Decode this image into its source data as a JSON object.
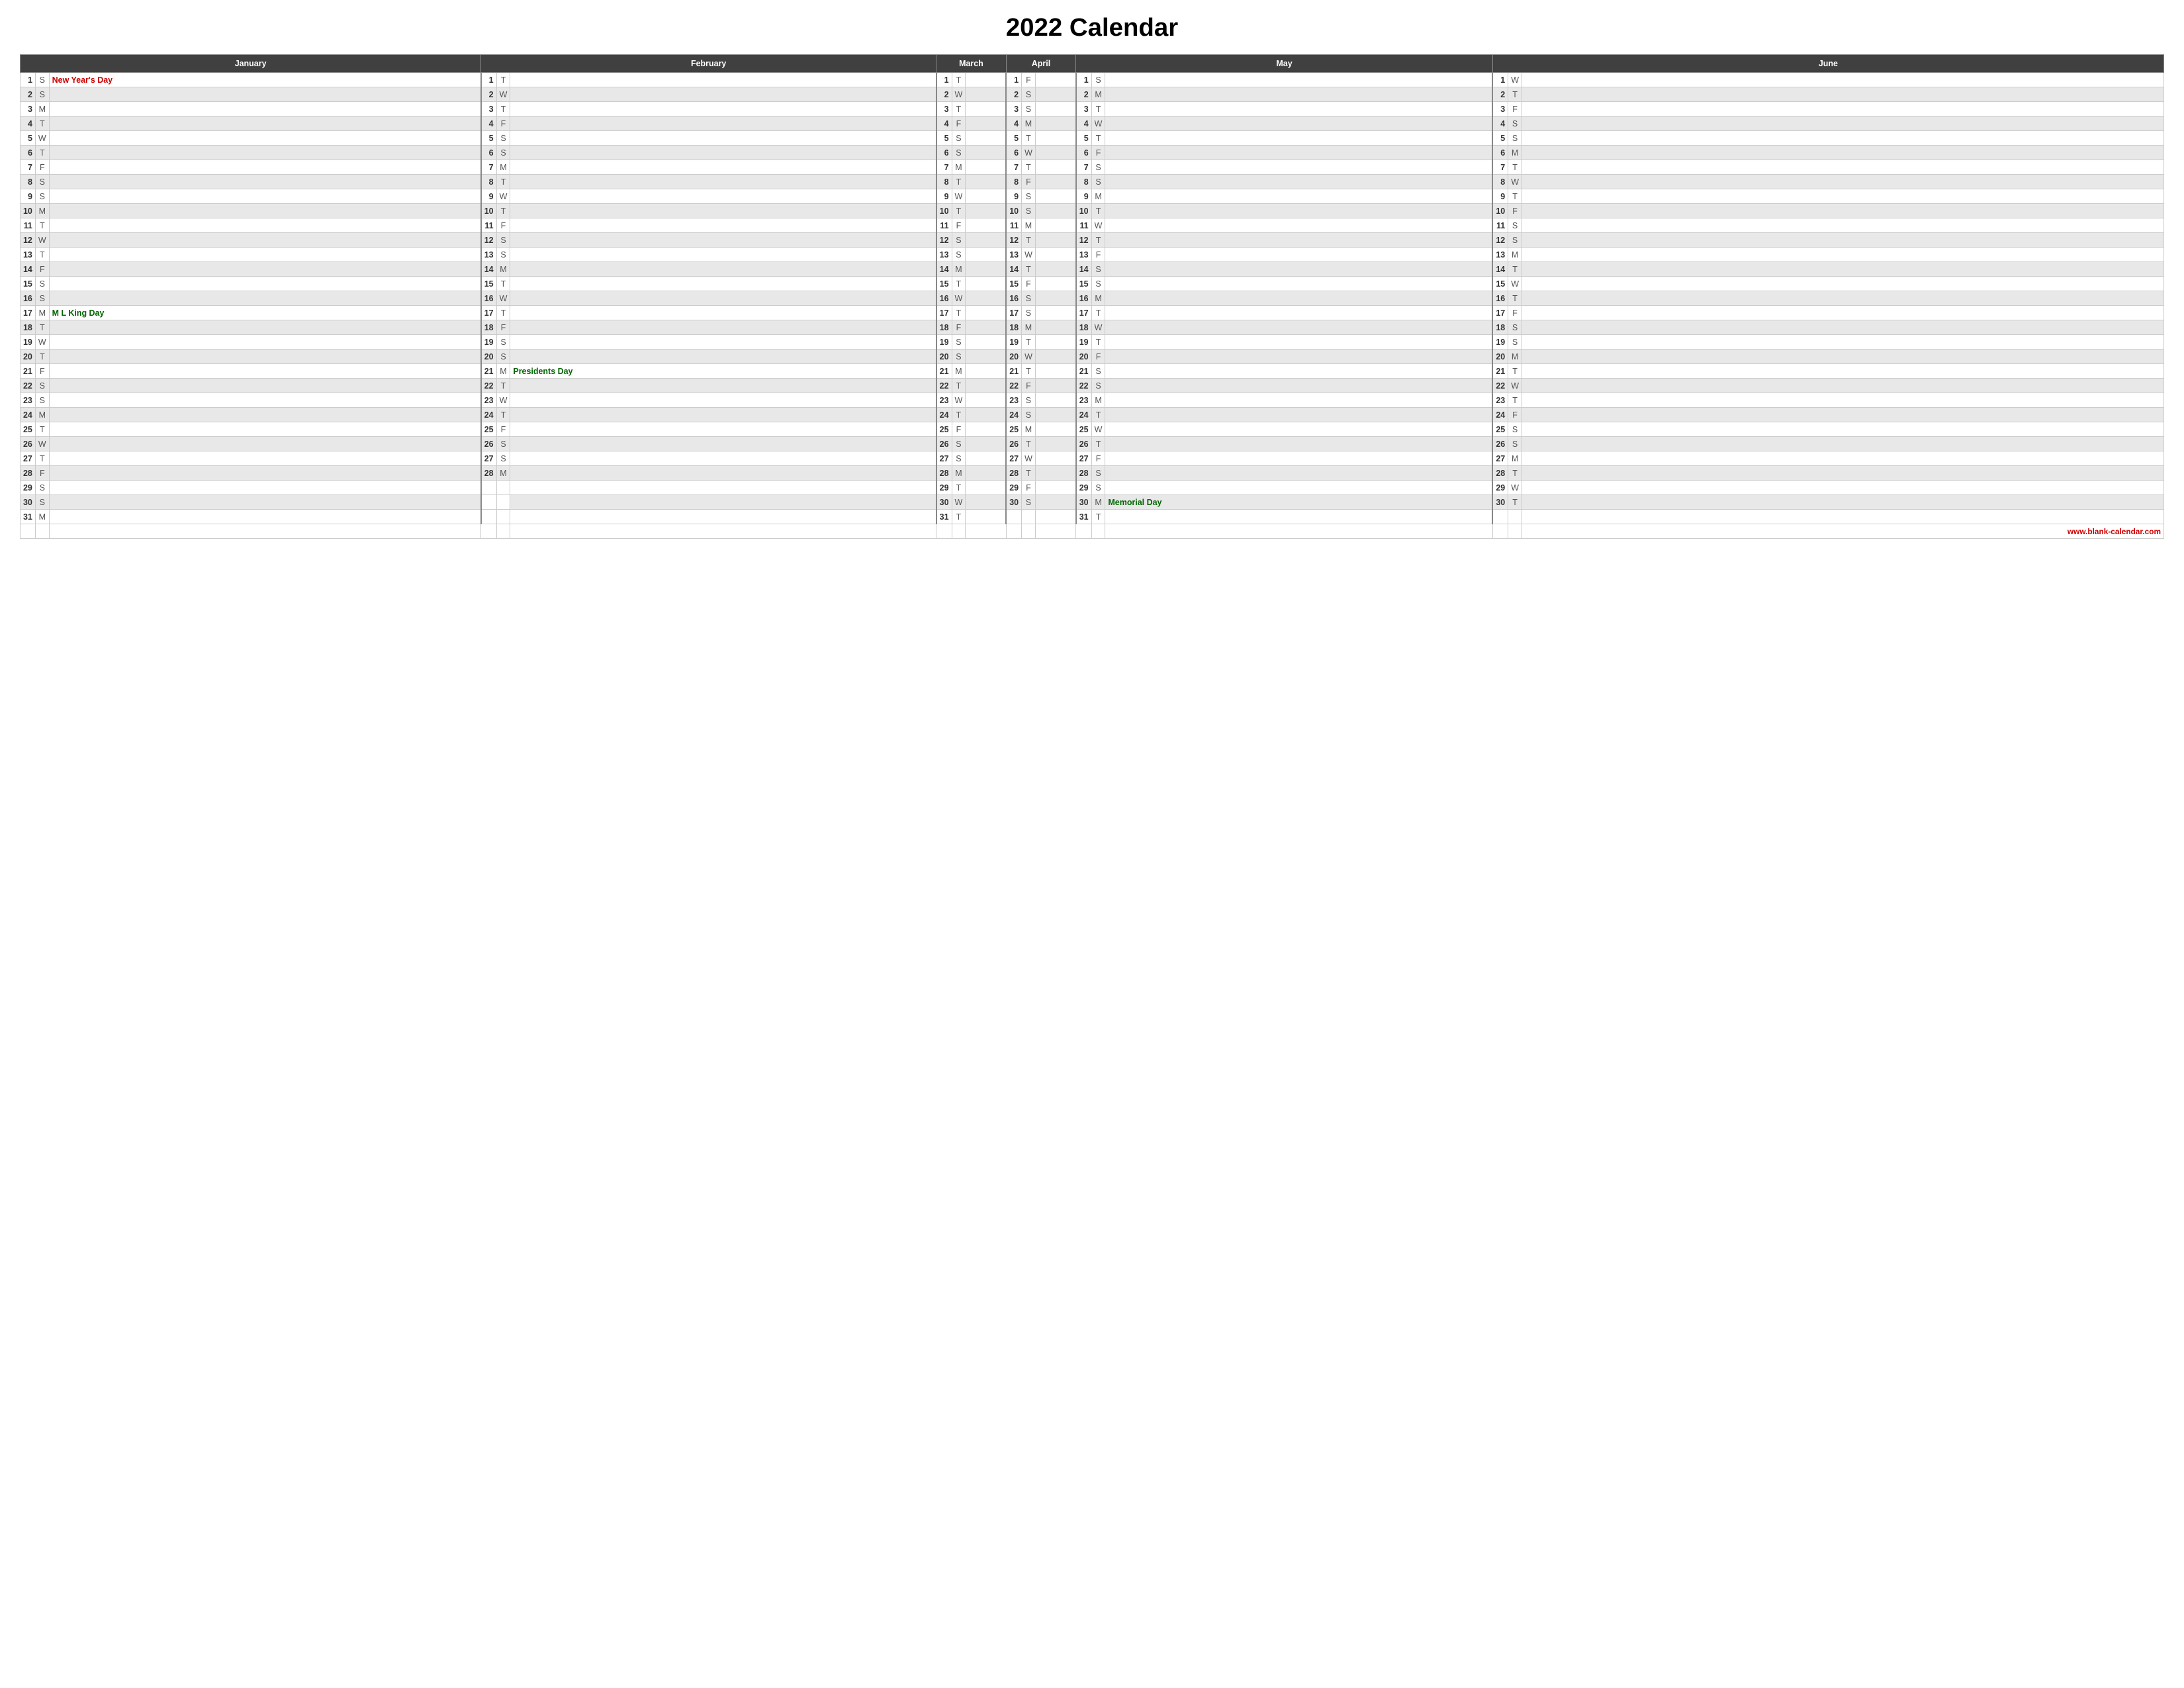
{
  "title": "2022 Calendar",
  "months": [
    "January",
    "February",
    "March",
    "April",
    "May",
    "June"
  ],
  "holidays": {
    "jan1": {
      "name": "New Year's Day",
      "color": "red"
    },
    "jan17": {
      "name": "M L King Day",
      "color": "green"
    },
    "feb21": {
      "name": "Presidents Day",
      "color": "green"
    },
    "may30": {
      "name": "Memorial Day",
      "color": "green"
    }
  },
  "footer": "www.blank-calendar.com",
  "rows": [
    {
      "n": 1,
      "jan": {
        "d": 1,
        "l": "S",
        "h": "New Year's Day",
        "hc": "red"
      },
      "feb": {
        "d": 1,
        "l": "T"
      },
      "mar": {
        "d": 1,
        "l": "T"
      },
      "apr": {
        "d": 1,
        "l": "F"
      },
      "may": {
        "d": 1,
        "l": "S"
      },
      "jun": {
        "d": 1,
        "l": "W"
      }
    },
    {
      "n": 2,
      "jan": {
        "d": 2,
        "l": "S"
      },
      "feb": {
        "d": 2,
        "l": "W"
      },
      "mar": {
        "d": 2,
        "l": "W"
      },
      "apr": {
        "d": 2,
        "l": "S"
      },
      "may": {
        "d": 2,
        "l": "M"
      },
      "jun": {
        "d": 2,
        "l": "T"
      }
    },
    {
      "n": 3,
      "jan": {
        "d": 3,
        "l": "M"
      },
      "feb": {
        "d": 3,
        "l": "T"
      },
      "mar": {
        "d": 3,
        "l": "T"
      },
      "apr": {
        "d": 3,
        "l": "S"
      },
      "may": {
        "d": 3,
        "l": "T"
      },
      "jun": {
        "d": 3,
        "l": "F"
      }
    },
    {
      "n": 4,
      "jan": {
        "d": 4,
        "l": "T"
      },
      "feb": {
        "d": 4,
        "l": "F"
      },
      "mar": {
        "d": 4,
        "l": "F"
      },
      "apr": {
        "d": 4,
        "l": "M"
      },
      "may": {
        "d": 4,
        "l": "W"
      },
      "jun": {
        "d": 4,
        "l": "S"
      }
    },
    {
      "n": 5,
      "jan": {
        "d": 5,
        "l": "W"
      },
      "feb": {
        "d": 5,
        "l": "S"
      },
      "mar": {
        "d": 5,
        "l": "S"
      },
      "apr": {
        "d": 5,
        "l": "T"
      },
      "may": {
        "d": 5,
        "l": "T"
      },
      "jun": {
        "d": 5,
        "l": "S"
      }
    },
    {
      "n": 6,
      "jan": {
        "d": 6,
        "l": "T"
      },
      "feb": {
        "d": 6,
        "l": "S"
      },
      "mar": {
        "d": 6,
        "l": "S"
      },
      "apr": {
        "d": 6,
        "l": "W"
      },
      "may": {
        "d": 6,
        "l": "F"
      },
      "jun": {
        "d": 6,
        "l": "M"
      }
    },
    {
      "n": 7,
      "jan": {
        "d": 7,
        "l": "F"
      },
      "feb": {
        "d": 7,
        "l": "M"
      },
      "mar": {
        "d": 7,
        "l": "M"
      },
      "apr": {
        "d": 7,
        "l": "T"
      },
      "may": {
        "d": 7,
        "l": "S"
      },
      "jun": {
        "d": 7,
        "l": "T"
      }
    },
    {
      "n": 8,
      "jan": {
        "d": 8,
        "l": "S"
      },
      "feb": {
        "d": 8,
        "l": "T"
      },
      "mar": {
        "d": 8,
        "l": "T"
      },
      "apr": {
        "d": 8,
        "l": "F"
      },
      "may": {
        "d": 8,
        "l": "S"
      },
      "jun": {
        "d": 8,
        "l": "W"
      }
    },
    {
      "n": 9,
      "jan": {
        "d": 9,
        "l": "S"
      },
      "feb": {
        "d": 9,
        "l": "W"
      },
      "mar": {
        "d": 9,
        "l": "W"
      },
      "apr": {
        "d": 9,
        "l": "S"
      },
      "may": {
        "d": 9,
        "l": "M"
      },
      "jun": {
        "d": 9,
        "l": "T"
      }
    },
    {
      "n": 10,
      "jan": {
        "d": 10,
        "l": "M"
      },
      "feb": {
        "d": 10,
        "l": "T"
      },
      "mar": {
        "d": 10,
        "l": "T"
      },
      "apr": {
        "d": 10,
        "l": "S"
      },
      "may": {
        "d": 10,
        "l": "T"
      },
      "jun": {
        "d": 10,
        "l": "F"
      }
    },
    {
      "n": 11,
      "jan": {
        "d": 11,
        "l": "T"
      },
      "feb": {
        "d": 11,
        "l": "F"
      },
      "mar": {
        "d": 11,
        "l": "F"
      },
      "apr": {
        "d": 11,
        "l": "M"
      },
      "may": {
        "d": 11,
        "l": "W"
      },
      "jun": {
        "d": 11,
        "l": "S"
      }
    },
    {
      "n": 12,
      "jan": {
        "d": 12,
        "l": "W"
      },
      "feb": {
        "d": 12,
        "l": "S"
      },
      "mar": {
        "d": 12,
        "l": "S"
      },
      "apr": {
        "d": 12,
        "l": "T"
      },
      "may": {
        "d": 12,
        "l": "T"
      },
      "jun": {
        "d": 12,
        "l": "S"
      }
    },
    {
      "n": 13,
      "jan": {
        "d": 13,
        "l": "T"
      },
      "feb": {
        "d": 13,
        "l": "S"
      },
      "mar": {
        "d": 13,
        "l": "S"
      },
      "apr": {
        "d": 13,
        "l": "W"
      },
      "may": {
        "d": 13,
        "l": "F"
      },
      "jun": {
        "d": 13,
        "l": "M"
      }
    },
    {
      "n": 14,
      "jan": {
        "d": 14,
        "l": "F"
      },
      "feb": {
        "d": 14,
        "l": "M"
      },
      "mar": {
        "d": 14,
        "l": "M"
      },
      "apr": {
        "d": 14,
        "l": "T"
      },
      "may": {
        "d": 14,
        "l": "S"
      },
      "jun": {
        "d": 14,
        "l": "T"
      }
    },
    {
      "n": 15,
      "jan": {
        "d": 15,
        "l": "S"
      },
      "feb": {
        "d": 15,
        "l": "T"
      },
      "mar": {
        "d": 15,
        "l": "T"
      },
      "apr": {
        "d": 15,
        "l": "F"
      },
      "may": {
        "d": 15,
        "l": "S"
      },
      "jun": {
        "d": 15,
        "l": "W"
      }
    },
    {
      "n": 16,
      "jan": {
        "d": 16,
        "l": "S"
      },
      "feb": {
        "d": 16,
        "l": "W"
      },
      "mar": {
        "d": 16,
        "l": "W"
      },
      "apr": {
        "d": 16,
        "l": "S"
      },
      "may": {
        "d": 16,
        "l": "M"
      },
      "jun": {
        "d": 16,
        "l": "T"
      }
    },
    {
      "n": 17,
      "jan": {
        "d": 17,
        "l": "M",
        "h": "M L King Day",
        "hc": "green"
      },
      "feb": {
        "d": 17,
        "l": "T"
      },
      "mar": {
        "d": 17,
        "l": "T"
      },
      "apr": {
        "d": 17,
        "l": "S"
      },
      "may": {
        "d": 17,
        "l": "T"
      },
      "jun": {
        "d": 17,
        "l": "F"
      }
    },
    {
      "n": 18,
      "jan": {
        "d": 18,
        "l": "T"
      },
      "feb": {
        "d": 18,
        "l": "F"
      },
      "mar": {
        "d": 18,
        "l": "F"
      },
      "apr": {
        "d": 18,
        "l": "M"
      },
      "may": {
        "d": 18,
        "l": "W"
      },
      "jun": {
        "d": 18,
        "l": "S"
      }
    },
    {
      "n": 19,
      "jan": {
        "d": 19,
        "l": "W"
      },
      "feb": {
        "d": 19,
        "l": "S"
      },
      "mar": {
        "d": 19,
        "l": "S"
      },
      "apr": {
        "d": 19,
        "l": "T"
      },
      "may": {
        "d": 19,
        "l": "T"
      },
      "jun": {
        "d": 19,
        "l": "S"
      }
    },
    {
      "n": 20,
      "jan": {
        "d": 20,
        "l": "T"
      },
      "feb": {
        "d": 20,
        "l": "S"
      },
      "mar": {
        "d": 20,
        "l": "S"
      },
      "apr": {
        "d": 20,
        "l": "W"
      },
      "may": {
        "d": 20,
        "l": "F"
      },
      "jun": {
        "d": 20,
        "l": "M"
      }
    },
    {
      "n": 21,
      "jan": {
        "d": 21,
        "l": "F"
      },
      "feb": {
        "d": 21,
        "l": "M",
        "h": "Presidents Day",
        "hc": "green"
      },
      "mar": {
        "d": 21,
        "l": "M"
      },
      "apr": {
        "d": 21,
        "l": "T"
      },
      "may": {
        "d": 21,
        "l": "S"
      },
      "jun": {
        "d": 21,
        "l": "T"
      }
    },
    {
      "n": 22,
      "jan": {
        "d": 22,
        "l": "S"
      },
      "feb": {
        "d": 22,
        "l": "T"
      },
      "mar": {
        "d": 22,
        "l": "T"
      },
      "apr": {
        "d": 22,
        "l": "F"
      },
      "may": {
        "d": 22,
        "l": "S"
      },
      "jun": {
        "d": 22,
        "l": "W"
      }
    },
    {
      "n": 23,
      "jan": {
        "d": 23,
        "l": "S"
      },
      "feb": {
        "d": 23,
        "l": "W"
      },
      "mar": {
        "d": 23,
        "l": "W"
      },
      "apr": {
        "d": 23,
        "l": "S"
      },
      "may": {
        "d": 23,
        "l": "M"
      },
      "jun": {
        "d": 23,
        "l": "T"
      }
    },
    {
      "n": 24,
      "jan": {
        "d": 24,
        "l": "M"
      },
      "feb": {
        "d": 24,
        "l": "T"
      },
      "mar": {
        "d": 24,
        "l": "T"
      },
      "apr": {
        "d": 24,
        "l": "S"
      },
      "may": {
        "d": 24,
        "l": "T"
      },
      "jun": {
        "d": 24,
        "l": "F"
      }
    },
    {
      "n": 25,
      "jan": {
        "d": 25,
        "l": "T"
      },
      "feb": {
        "d": 25,
        "l": "F"
      },
      "mar": {
        "d": 25,
        "l": "F"
      },
      "apr": {
        "d": 25,
        "l": "M"
      },
      "may": {
        "d": 25,
        "l": "W"
      },
      "jun": {
        "d": 25,
        "l": "S"
      }
    },
    {
      "n": 26,
      "jan": {
        "d": 26,
        "l": "W"
      },
      "feb": {
        "d": 26,
        "l": "S"
      },
      "mar": {
        "d": 26,
        "l": "S"
      },
      "apr": {
        "d": 26,
        "l": "T"
      },
      "may": {
        "d": 26,
        "l": "T"
      },
      "jun": {
        "d": 26,
        "l": "S"
      }
    },
    {
      "n": 27,
      "jan": {
        "d": 27,
        "l": "T"
      },
      "feb": {
        "d": 27,
        "l": "S"
      },
      "mar": {
        "d": 27,
        "l": "S"
      },
      "apr": {
        "d": 27,
        "l": "W"
      },
      "may": {
        "d": 27,
        "l": "F"
      },
      "jun": {
        "d": 27,
        "l": "M"
      }
    },
    {
      "n": 28,
      "jan": {
        "d": 28,
        "l": "F"
      },
      "feb": {
        "d": 28,
        "l": "M"
      },
      "mar": {
        "d": 28,
        "l": "M"
      },
      "apr": {
        "d": 28,
        "l": "T"
      },
      "may": {
        "d": 28,
        "l": "S"
      },
      "jun": {
        "d": 28,
        "l": "T"
      }
    },
    {
      "n": 29,
      "jan": {
        "d": 29,
        "l": "S"
      },
      "feb": null,
      "mar": {
        "d": 29,
        "l": "T"
      },
      "apr": {
        "d": 29,
        "l": "F"
      },
      "may": {
        "d": 29,
        "l": "S"
      },
      "jun": {
        "d": 29,
        "l": "W"
      }
    },
    {
      "n": 30,
      "jan": {
        "d": 30,
        "l": "S"
      },
      "feb": null,
      "mar": {
        "d": 30,
        "l": "W"
      },
      "apr": {
        "d": 30,
        "l": "S"
      },
      "may": {
        "d": 30,
        "l": "M",
        "h": "Memorial Day",
        "hc": "green"
      },
      "jun": {
        "d": 30,
        "l": "T"
      }
    },
    {
      "n": 31,
      "jan": {
        "d": 31,
        "l": "M"
      },
      "feb": null,
      "mar": {
        "d": 31,
        "l": "T"
      },
      "apr": null,
      "may": {
        "d": 31,
        "l": "T"
      },
      "jun": null
    }
  ]
}
